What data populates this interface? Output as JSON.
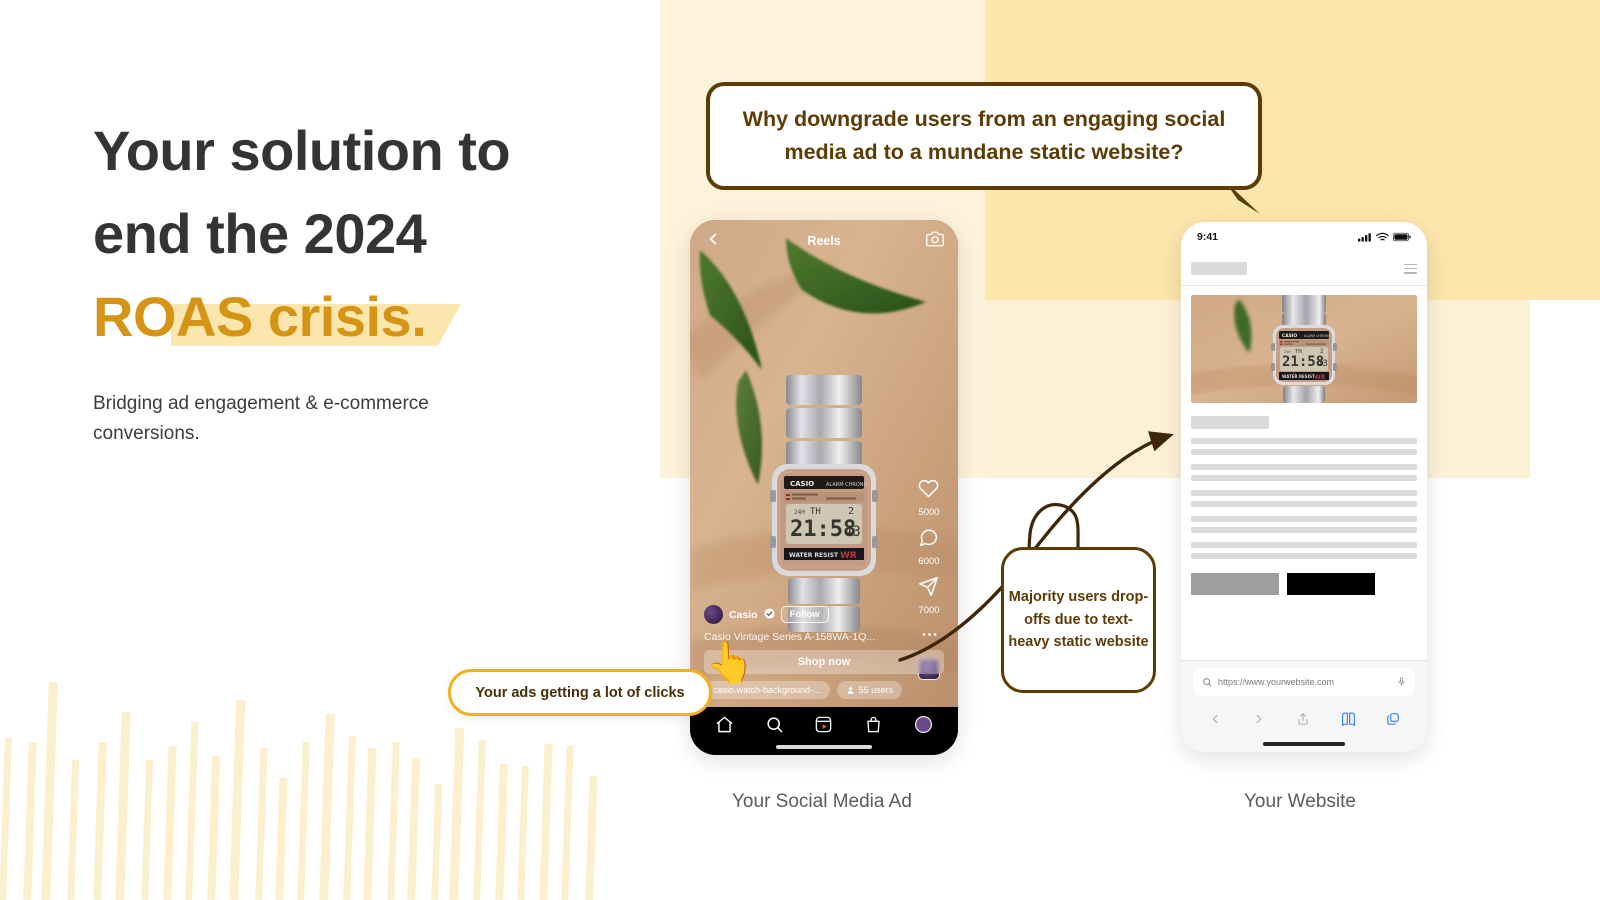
{
  "hero": {
    "headline_line1": "Your solution to",
    "headline_line2": "end the 2024",
    "headline_accent": "ROAS crisis.",
    "subcopy": "Bridging ad engagement & e-commerce conversions.",
    "accent_color": "#D69416",
    "highlight_color": "#FBE6AE",
    "text_color": "#343434"
  },
  "speech_bubble": {
    "text": "Why downgrade users from an engaging social media ad to a mundane static website?",
    "border_color": "#5C3B05",
    "text_color": "#5C3B05"
  },
  "social_phone": {
    "header_title": "Reels",
    "back_icon": "chevron-left-icon",
    "camera_icon": "camera-icon",
    "account_name": "Casio",
    "verified_icon": "verified-badge-icon",
    "follow_label": "Follow",
    "caption": "Casio Vintage Series A-158WA-1Q...",
    "cta_label": "Shop now",
    "audio_pill": "casio.watch-background-...",
    "users_pill": "55 users",
    "users_icon": "person-icon",
    "engagement": [
      {
        "icon": "heart-icon",
        "count": "5000"
      },
      {
        "icon": "comment-icon",
        "count": "6000"
      },
      {
        "icon": "share-icon",
        "count": "7000"
      }
    ],
    "more_icon": "more-dots-icon",
    "nav_items": [
      {
        "icon": "home-icon"
      },
      {
        "icon": "search-icon"
      },
      {
        "icon": "reels-icon"
      },
      {
        "icon": "shop-bag-icon"
      },
      {
        "icon": "profile-avatar-icon"
      }
    ],
    "pointer_emoji": "👆",
    "caption_below": "Your Social Media Ad"
  },
  "website_phone": {
    "status_time": "9:41",
    "status_icons": [
      "cellular-signal-icon",
      "wifi-icon",
      "battery-icon"
    ],
    "menu_icon": "hamburger-menu-icon",
    "url": "https://www.yourwebsite.com",
    "url_search_icon": "search-icon",
    "url_mic_icon": "microphone-icon",
    "toolbar_icons": [
      "back-chevron-icon",
      "forward-chevron-icon",
      "share-icon",
      "bookmarks-book-icon",
      "tabs-icon"
    ],
    "skeleton_line_groups": 5,
    "skeleton_lines_per_group": 2,
    "caption_below": "Your Website"
  },
  "callouts": {
    "clicks": {
      "text": "Your ads getting a lot of clicks",
      "border_color": "#EFB21A",
      "text_color": "#4A2F06"
    },
    "dropoff": {
      "text": "Majority users drop-offs due to text-heavy static website",
      "border_color": "#5C3B05",
      "text_color": "#5C3B05"
    }
  },
  "background": {
    "panel_light": "#FDF2DA",
    "panel_deep": "#FCE6AC",
    "panel_mid": "#FCF1D7",
    "stripe_color": "#FBEFCE"
  }
}
